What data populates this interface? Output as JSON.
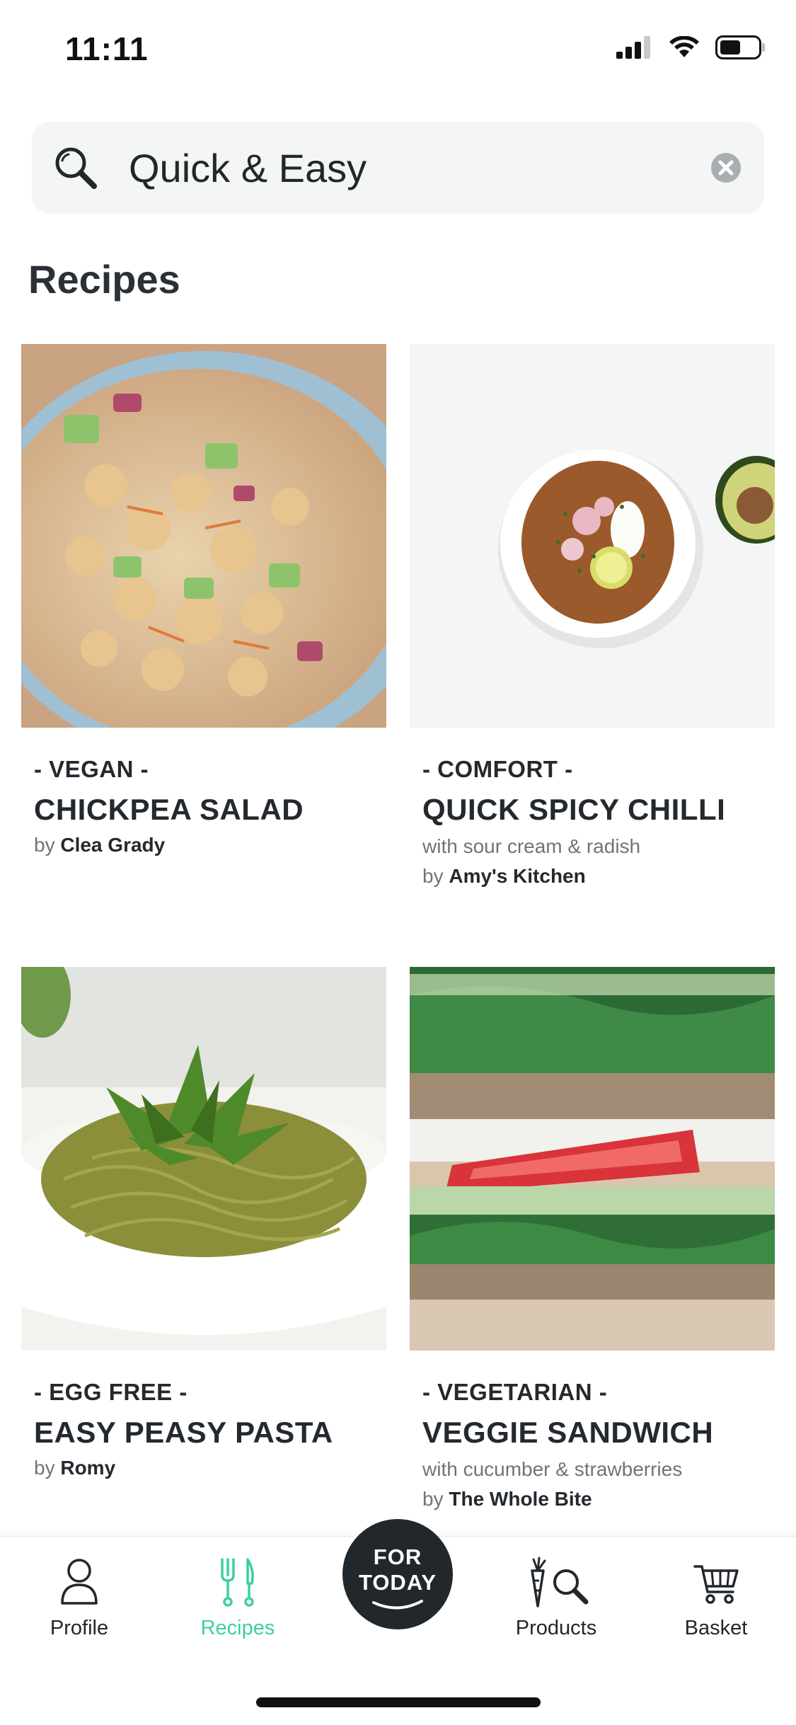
{
  "status": {
    "time": "11:11"
  },
  "search": {
    "value": "Quick & Easy"
  },
  "section": {
    "title": "Recipes"
  },
  "cards": [
    {
      "tag": "- VEGAN -",
      "title": "CHICKPEA SALAD",
      "subtitle": "",
      "author_prefix": "by",
      "author": "Clea Grady"
    },
    {
      "tag": "- COMFORT -",
      "title": "QUICK SPICY CHILLI",
      "subtitle": "with sour cream & radish",
      "author_prefix": "by",
      "author": "Amy's Kitchen"
    },
    {
      "tag": "- EGG FREE -",
      "title": "EASY PEASY PASTA",
      "subtitle": "",
      "author_prefix": "by",
      "author": "Romy"
    },
    {
      "tag": "- VEGETARIAN -",
      "title": "VEGGIE SANDWICH",
      "subtitle": "with cucumber & strawberries",
      "author_prefix": "by",
      "author": "The Whole Bite"
    }
  ],
  "nav": {
    "profile": "Profile",
    "recipes": "Recipes",
    "for_today": "FOR TODAY",
    "products": "Products",
    "basket": "Basket"
  },
  "colors": {
    "accent": "#3ecfa3",
    "text": "#22272b",
    "muted": "#6f7479"
  }
}
